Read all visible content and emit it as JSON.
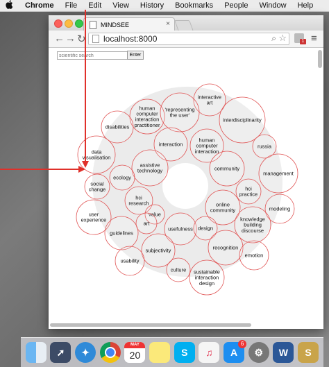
{
  "menubar": {
    "items": [
      "Chrome",
      "File",
      "Edit",
      "View",
      "History",
      "Bookmarks",
      "People",
      "Window",
      "Help"
    ]
  },
  "browser": {
    "tab_title": "MINDSEE",
    "url": "localhost:8000",
    "extension_badge": "1"
  },
  "page": {
    "search_placeholder": "scientific search",
    "enter_label": "Enter",
    "keywords": [
      "interactive art",
      "human computer interaction practitioner",
      "'representing the user'",
      "interdisciplinarity",
      "disabilities",
      "interaction",
      "human computer interaction",
      "russia",
      "data visualisation",
      "assistive technology",
      "community",
      "management",
      "ecology",
      "social change",
      "hci practice",
      "hci research",
      "online community",
      "modeling",
      "user experience",
      "value",
      "knowledge building discourse",
      "art",
      "usefulness",
      "design",
      "guidelines",
      "recognition",
      "subjectivity",
      "emotion",
      "usability",
      "culture",
      "sustainable interaction design"
    ]
  },
  "dock": {
    "calendar_month": "MAY",
    "calendar_day": "20",
    "appstore_badge": "6",
    "word_label": "W"
  }
}
